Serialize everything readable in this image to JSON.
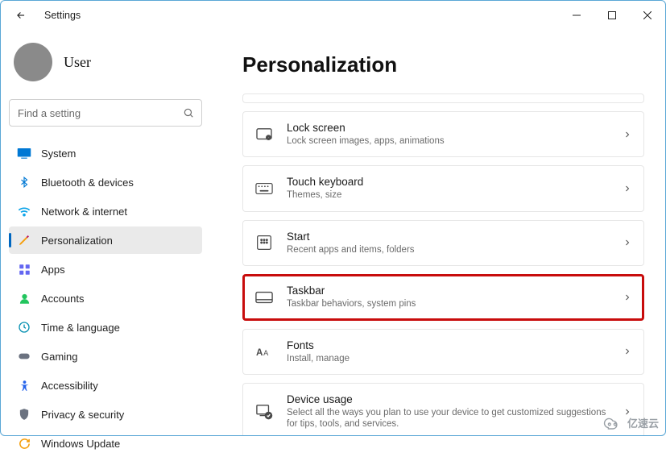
{
  "window": {
    "title": "Settings"
  },
  "profile": {
    "username": "User"
  },
  "search": {
    "placeholder": "Find a setting"
  },
  "sidebar": {
    "items": [
      {
        "label": "System"
      },
      {
        "label": "Bluetooth & devices"
      },
      {
        "label": "Network & internet"
      },
      {
        "label": "Personalization"
      },
      {
        "label": "Apps"
      },
      {
        "label": "Accounts"
      },
      {
        "label": "Time & language"
      },
      {
        "label": "Gaming"
      },
      {
        "label": "Accessibility"
      },
      {
        "label": "Privacy & security"
      },
      {
        "label": "Windows Update"
      }
    ],
    "selected_index": 3
  },
  "page": {
    "title": "Personalization"
  },
  "settings_rows": [
    {
      "title": "Lock screen",
      "subtitle": "Lock screen images, apps, animations"
    },
    {
      "title": "Touch keyboard",
      "subtitle": "Themes, size"
    },
    {
      "title": "Start",
      "subtitle": "Recent apps and items, folders"
    },
    {
      "title": "Taskbar",
      "subtitle": "Taskbar behaviors, system pins"
    },
    {
      "title": "Fonts",
      "subtitle": "Install, manage"
    },
    {
      "title": "Device usage",
      "subtitle": "Select all the ways you plan to use your device to get customized suggestions for tips, tools, and services."
    }
  ],
  "highlighted_row_index": 3,
  "watermark": "亿速云"
}
